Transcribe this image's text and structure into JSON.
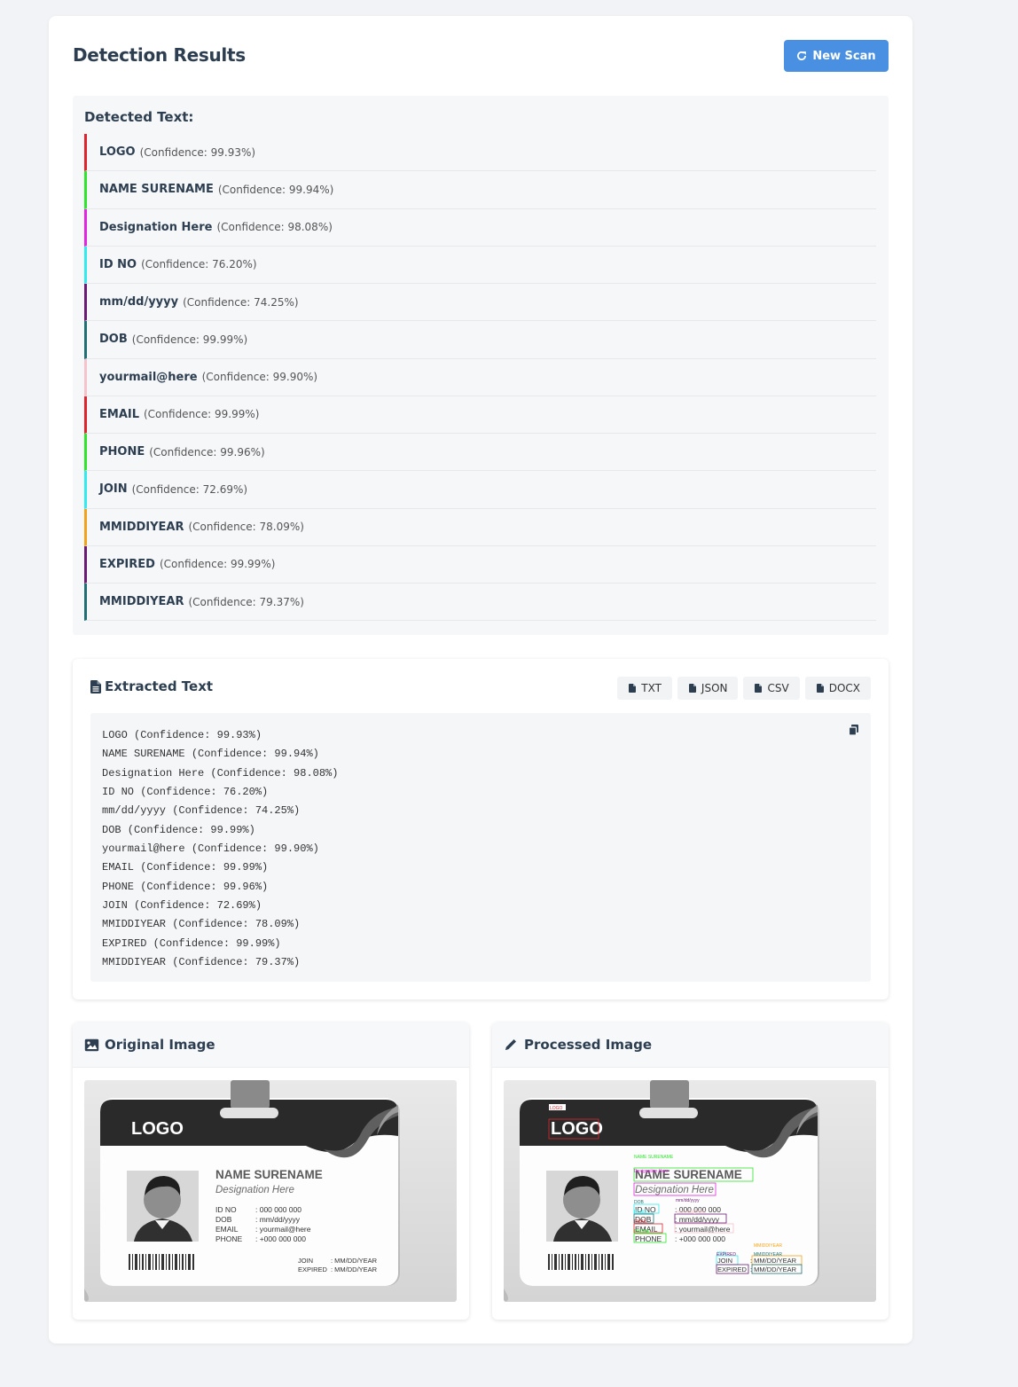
{
  "header": {
    "title": "Detection Results",
    "new_scan_label": "New Scan"
  },
  "detected": {
    "heading": "Detected Text:",
    "items": [
      {
        "text": "LOGO",
        "confidence": "(Confidence: 99.93%)",
        "color": "#e0242b"
      },
      {
        "text": "NAME SURENAME",
        "confidence": "(Confidence: 99.94%)",
        "color": "#2ee62e"
      },
      {
        "text": "Designation Here",
        "confidence": "(Confidence: 98.08%)",
        "color": "#e324e3"
      },
      {
        "text": "ID NO",
        "confidence": "(Confidence: 76.20%)",
        "color": "#33eaf0"
      },
      {
        "text": "mm/dd/yyyy",
        "confidence": "(Confidence: 74.25%)",
        "color": "#6a1a72"
      },
      {
        "text": "DOB",
        "confidence": "(Confidence: 99.99%)",
        "color": "#1f6f74"
      },
      {
        "text": "yourmail@here",
        "confidence": "(Confidence: 99.90%)",
        "color": "#f6c2cc"
      },
      {
        "text": "EMAIL",
        "confidence": "(Confidence: 99.99%)",
        "color": "#e0242b"
      },
      {
        "text": "PHONE",
        "confidence": "(Confidence: 99.96%)",
        "color": "#2ee62e"
      },
      {
        "text": "JOIN",
        "confidence": "(Confidence: 72.69%)",
        "color": "#33eaf0"
      },
      {
        "text": "MMIDDIYEAR",
        "confidence": "(Confidence: 78.09%)",
        "color": "#f2a31b"
      },
      {
        "text": "EXPIRED",
        "confidence": "(Confidence: 99.99%)",
        "color": "#6a1a72"
      },
      {
        "text": "MMIDDIYEAR",
        "confidence": "(Confidence: 79.37%)",
        "color": "#1f6f74"
      }
    ]
  },
  "extracted": {
    "title": "Extracted Text",
    "downloads": [
      "TXT",
      "JSON",
      "CSV",
      "DOCX"
    ],
    "lines": [
      "LOGO (Confidence: 99.93%)",
      "NAME SURENAME (Confidence: 99.94%)",
      "Designation Here (Confidence: 98.08%)",
      "ID NO (Confidence: 76.20%)",
      "mm/dd/yyyy (Confidence: 74.25%)",
      "DOB (Confidence: 99.99%)",
      "yourmail@here (Confidence: 99.90%)",
      "EMAIL (Confidence: 99.99%)",
      "PHONE (Confidence: 99.96%)",
      "JOIN (Confidence: 72.69%)",
      "MMIDDIYEAR (Confidence: 78.09%)",
      "EXPIRED (Confidence: 99.99%)",
      "MMIDDIYEAR (Confidence: 79.37%)"
    ]
  },
  "images": {
    "original_title": "Original Image",
    "processed_title": "Processed Image",
    "card": {
      "logo": "LOGO",
      "name": "NAME SURENAME",
      "designation": "Designation Here",
      "fields": [
        {
          "label": "ID NO",
          "value": ": 000 000 000"
        },
        {
          "label": "DOB",
          "value": ": mm/dd/yyyy"
        },
        {
          "label": "EMAIL",
          "value": ": yourmail@here"
        },
        {
          "label": "PHONE",
          "value": ": +000 000 000"
        }
      ],
      "dates": [
        {
          "label": "JOIN",
          "value": ": MM/DD/YEAR"
        },
        {
          "label": "EXPIRED",
          "value": ": MM/DD/YEAR"
        }
      ]
    }
  }
}
